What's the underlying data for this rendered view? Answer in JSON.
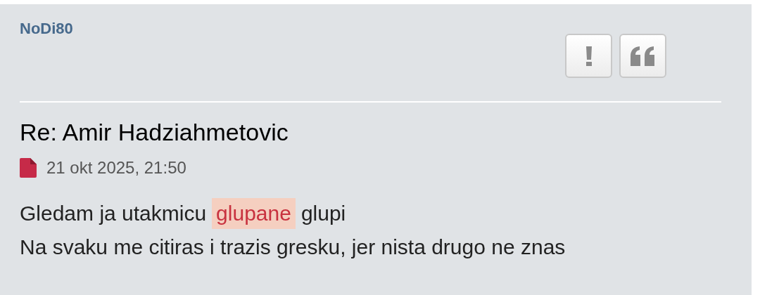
{
  "post": {
    "author": "NoDi80",
    "actions": [
      {
        "kind": "report"
      },
      {
        "kind": "quote"
      }
    ],
    "title": "Re: Amir Hadziahmetovic",
    "date": "21 okt 2025, 21:50",
    "body": [
      [
        {
          "text": "Gledam ja utakmicu",
          "highlight": false
        },
        {
          "text": "glupane",
          "highlight": true
        },
        {
          "text": "glupi",
          "highlight": false
        }
      ],
      [
        {
          "text": "Na svaku me citiras i trazis gresku, jer nista drugo ne znas",
          "highlight": false
        }
      ]
    ]
  }
}
